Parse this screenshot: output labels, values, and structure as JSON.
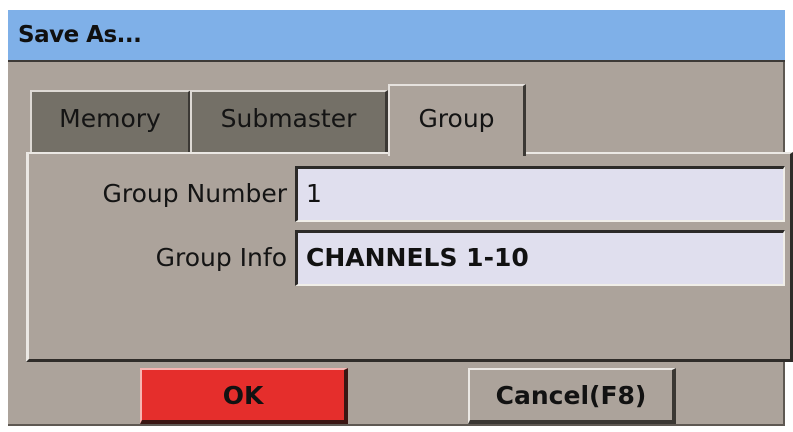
{
  "window": {
    "title": "Save As..."
  },
  "tabs": [
    {
      "label": "Memory",
      "active": false
    },
    {
      "label": "Submaster",
      "active": false
    },
    {
      "label": "Group",
      "active": true
    }
  ],
  "form": {
    "group_number_label": "Group Number",
    "group_number_value": "1",
    "group_info_label": "Group Info",
    "group_info_value": "CHANNELS 1-10"
  },
  "buttons": {
    "ok_label": "OK",
    "cancel_label": "Cancel(F8)"
  },
  "colors": {
    "titlebar": "#7fb0e8",
    "dialog_bg": "#aca39b",
    "ok_button": "#e52e2c",
    "field_bg": "#e0dfee"
  }
}
